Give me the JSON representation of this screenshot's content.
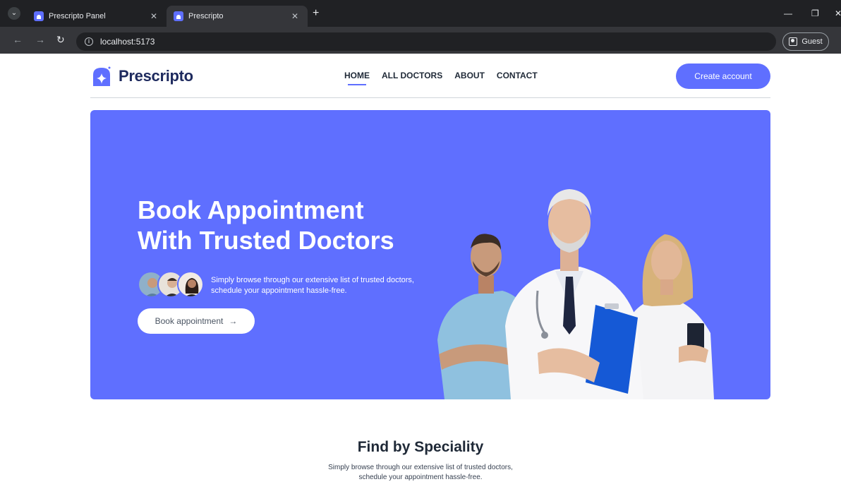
{
  "browser": {
    "tabs": [
      {
        "title": "Prescripto Panel",
        "active": false
      },
      {
        "title": "Prescripto",
        "active": true
      }
    ],
    "url": "localhost:5173",
    "profile_label": "Guest"
  },
  "header": {
    "logo_text": "Prescripto",
    "nav": [
      "HOME",
      "ALL DOCTORS",
      "ABOUT",
      "CONTACT"
    ],
    "active_nav": "HOME",
    "cta_label": "Create account"
  },
  "hero": {
    "title_line1": "Book Appointment",
    "title_line2": "With Trusted Doctors",
    "subtitle_line1": "Simply browse through our extensive list of trusted doctors,",
    "subtitle_line2": "schedule your appointment hassle-free.",
    "button_label": "Book appointment",
    "button_arrow": "→"
  },
  "speciality": {
    "title": "Find by Speciality",
    "subtitle_line1": "Simply browse through our extensive list of trusted doctors,",
    "subtitle_line2": "schedule your appointment hassle-free."
  },
  "colors": {
    "primary": "#5f6fff",
    "logo_text": "#1e2a5e"
  }
}
